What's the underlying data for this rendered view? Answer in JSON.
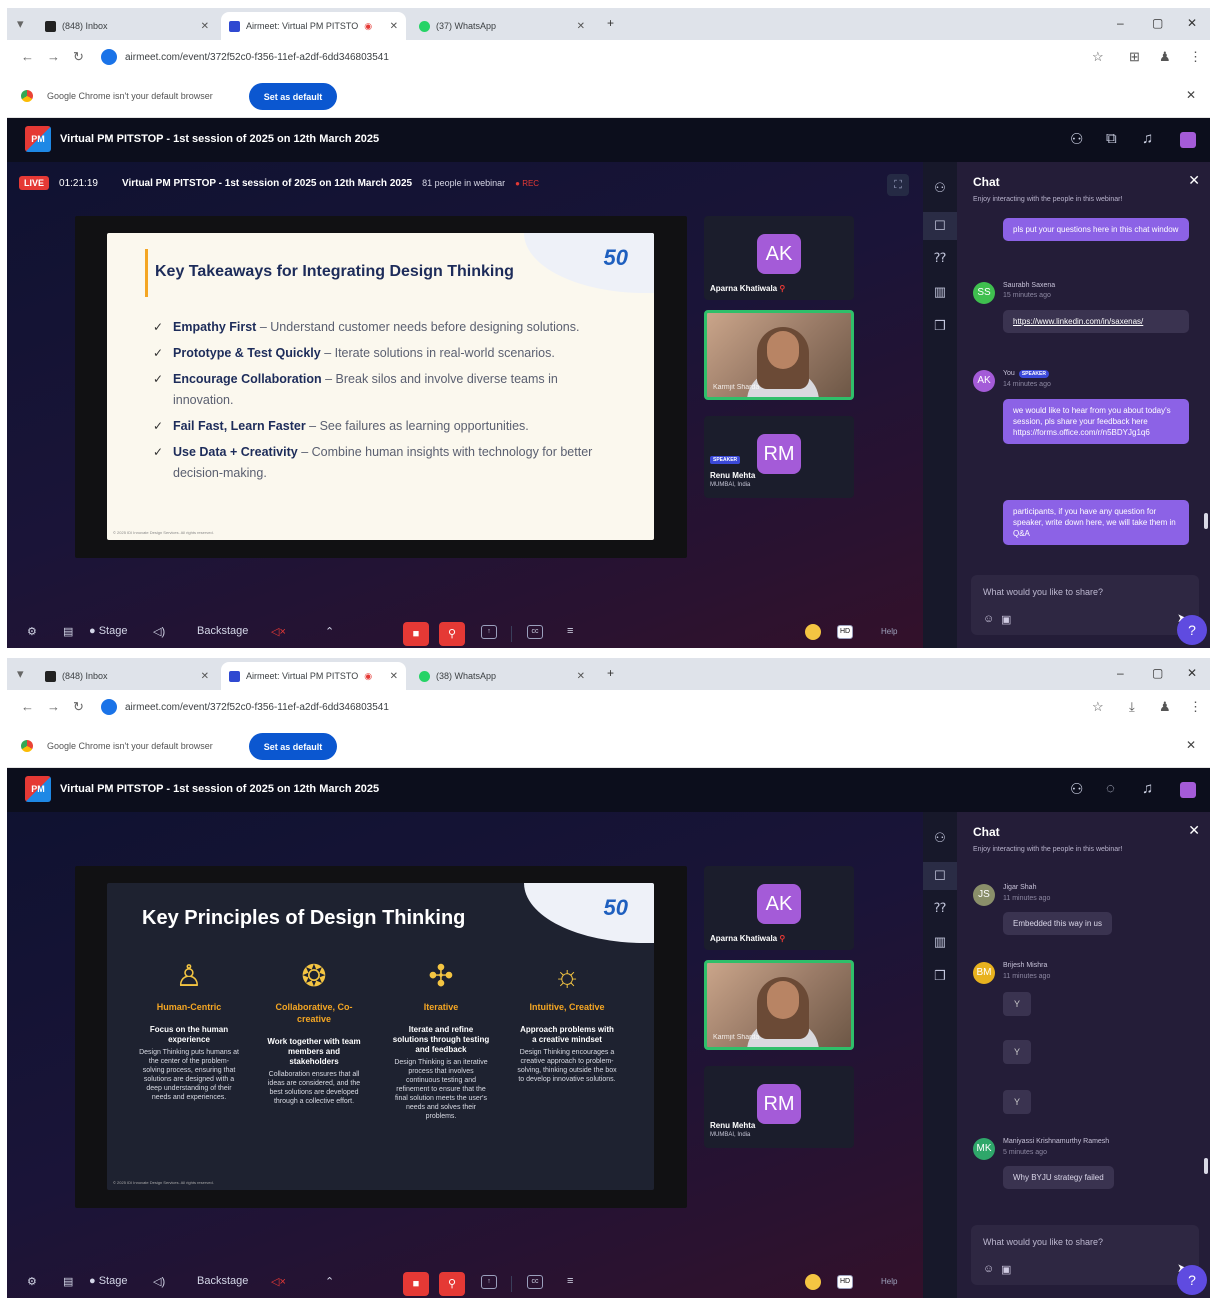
{
  "shots": [
    {
      "browser": {
        "tabs": [
          {
            "label": "(848) Inbox"
          },
          {
            "label": "Airmeet: Virtual PM PITSTO"
          },
          {
            "label": "(37) WhatsApp"
          }
        ],
        "url": "airmeet.com/event/372f52c0-f356-11ef-a2df-6dd346803541",
        "infobar_message": "Google Chrome isn't your default browser",
        "set_default_label": "Set as default"
      },
      "app": {
        "title": "Virtual PM PITSTOP - 1st session of 2025 on 12th March 2025",
        "live_label": "LIVE",
        "timer": "01:21:19",
        "session_title": "Virtual PM PITSTOP - 1st session of 2025 on 12th March 2025",
        "attendees": "81 people in webinar",
        "rec_label": "REC"
      },
      "slide": {
        "title": "Key Takeaways for Integrating Design Thinking",
        "anniv": "50",
        "bullets": [
          {
            "bold": "Empathy First",
            "text": " – Understand customer needs before designing solutions."
          },
          {
            "bold": "Prototype & Test Quickly",
            "text": " – Iterate solutions in real-world scenarios."
          },
          {
            "bold": "Encourage Collaboration",
            "text": " – Break silos and involve diverse teams in innovation."
          },
          {
            "bold": "Fail Fast, Learn Faster",
            "text": " – See failures as learning opportunities."
          },
          {
            "bold": "Use Data + Creativity",
            "text": " – Combine human insights with technology for better decision-making."
          }
        ],
        "copyright": "© 2025 IDI Innovate Design Services. All rights reserved."
      },
      "videos": {
        "ak_initials": "AK",
        "ak_name": "Aparna Khatiwala",
        "cam_name": "Karmjit Sharda",
        "rm_initials": "RM",
        "rm_name": "Renu Mehta",
        "rm_location": "MUMBAI, India",
        "speaker_badge": "SPEAKER"
      },
      "chat": {
        "title": "Chat",
        "subtitle": "Enjoy interacting with the people in this webinar!",
        "messages": [
          {
            "text": "pls put your questions here in this chat window"
          },
          {
            "initials": "SS",
            "name": "Saurabh Saxena",
            "time": "15 minutes ago",
            "text": "https://www.linkedin.com/in/saxenas/"
          },
          {
            "initials": "AK",
            "name": "You",
            "badge": "SPEAKER",
            "time": "14 minutes ago",
            "text": "we would like to hear from you about today's session, pls share your feedback here https://forms.office.com/r/n5BDYJg1q6"
          },
          {
            "text": "participants, if you have any question for speaker, write down here, we will take them in Q&A"
          }
        ],
        "input_placeholder": "What would you like to share?"
      },
      "bottombar": {
        "stage_label": "Stage",
        "backstage_label": "Backstage",
        "help_label": "Help",
        "hd_label": "HD"
      }
    },
    {
      "browser": {
        "tabs": [
          {
            "label": "(848) Inbox"
          },
          {
            "label": "Airmeet: Virtual PM PITSTO"
          },
          {
            "label": "(38) WhatsApp"
          }
        ],
        "url": "airmeet.com/event/372f52c0-f356-11ef-a2df-6dd346803541",
        "infobar_message": "Google Chrome isn't your default browser",
        "set_default_label": "Set as default"
      },
      "app": {
        "title": "Virtual PM PITSTOP - 1st session of 2025 on 12th March 2025"
      },
      "slide": {
        "title": "Key Principles of Design Thinking",
        "anniv": "50",
        "principles": [
          {
            "icon": "person-icon",
            "glyph": "♙",
            "head": "Human-Centric",
            "sub": "Focus on the human experience",
            "body": "Design Thinking puts humans at the center of the problem-solving process, ensuring that solutions are designed with a deep understanding of their needs and experiences."
          },
          {
            "icon": "collaboration-icon",
            "glyph": "❂",
            "head": "Collaborative, Co-creative",
            "sub": "Work together with team members and stakeholders",
            "body": "Collaboration ensures that all ideas are considered, and the best solutions are developed through a collective effort."
          },
          {
            "icon": "iterative-icon",
            "glyph": "✣",
            "head": "Iterative",
            "sub": "Iterate and refine solutions through testing and feedback",
            "body": "Design Thinking is an iterative process that involves continuous testing and refinement to ensure that the final solution meets the user's needs and solves their problems."
          },
          {
            "icon": "lightbulb-icon",
            "glyph": "☼",
            "head": "Intuitive, Creative",
            "sub": "Approach problems with a creative mindset",
            "body": "Design Thinking encourages a creative approach to problem-solving, thinking outside the box to develop innovative solutions."
          }
        ],
        "copyright": "© 2025 IDI Innovate Design Services. All rights reserved."
      },
      "videos": {
        "ak_initials": "AK",
        "ak_name": "Aparna Khatiwala",
        "cam_name": "Karmjit Sharda",
        "rm_initials": "RM",
        "rm_name": "Renu Mehta",
        "rm_location": "MUMBAI, India"
      },
      "chat": {
        "title": "Chat",
        "subtitle": "Enjoy interacting with the people in this webinar!",
        "messages": [
          {
            "initials": "JS",
            "name": "Jigar Shah",
            "time": "11 minutes ago",
            "text": "Embedded this way in us"
          },
          {
            "initials": "BM",
            "name": "Brijesh Mishra",
            "time": "11 minutes ago",
            "text": "Y"
          },
          {
            "text": "Y"
          },
          {
            "text": "Y"
          },
          {
            "initials": "MK",
            "name": "Maniyassi Krishnamurthy Ramesh",
            "time": "5 minutes ago",
            "text": "Why BYJU strategy failed"
          }
        ],
        "input_placeholder": "What would you like to share?"
      },
      "bottombar": {
        "stage_label": "Stage",
        "backstage_label": "Backstage",
        "help_label": "Help",
        "hd_label": "HD"
      }
    }
  ]
}
